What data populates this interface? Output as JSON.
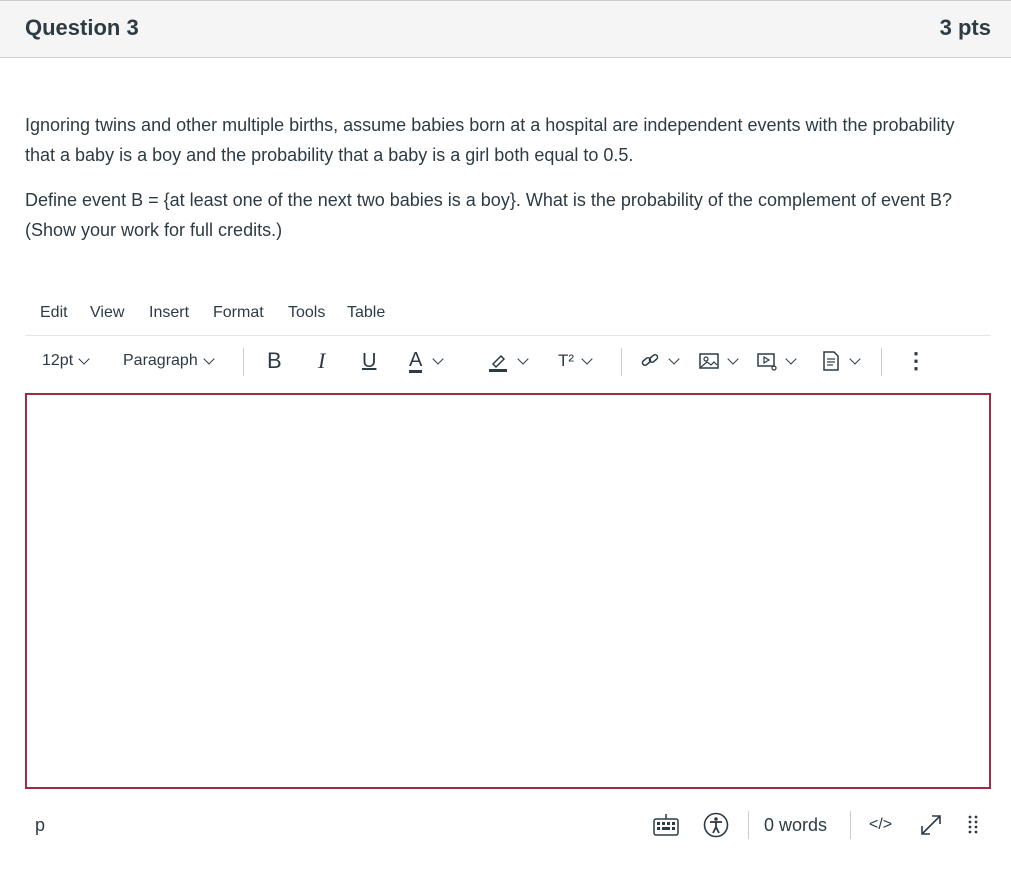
{
  "question": {
    "title": "Question 3",
    "points": "3 pts",
    "paragraphs": [
      "Ignoring twins and other multiple births, assume babies born at a hospital are independent events with the probability that a baby is a boy and the probability that a baby is a girl both equal to 0.5.",
      "Define event B = {at least one of the next two babies is a boy}. What is the probability of the complement of event B? (Show your work for full credits.)"
    ]
  },
  "menubar": {
    "items": [
      "Edit",
      "View",
      "Insert",
      "Format",
      "Tools",
      "Table"
    ]
  },
  "toolbar": {
    "font_size": "12pt",
    "block_format": "Paragraph",
    "bold": "B",
    "italic": "I",
    "underline": "U",
    "text_color": "A",
    "superscript": "T²",
    "more": "⋮"
  },
  "editor": {
    "content": ""
  },
  "statusbar": {
    "element_path": "p",
    "word_count": "0 words",
    "html_toggle": "</>"
  },
  "colors": {
    "focus_border": "#a22a45",
    "text": "#2d3b45",
    "header_bg": "#f5f5f5"
  }
}
